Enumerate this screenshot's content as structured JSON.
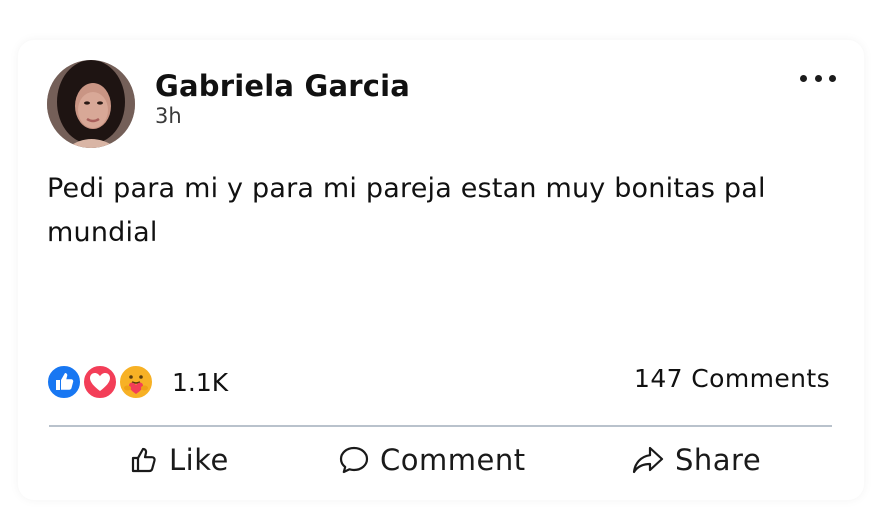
{
  "post": {
    "author_name": "Gabriela Garcia",
    "timestamp": "3h",
    "text": "Pedi para mi y para mi pareja estan muy bonitas pal mundial"
  },
  "reactions": {
    "icons": [
      "like-icon",
      "love-icon",
      "care-icon"
    ],
    "count": "1.1K"
  },
  "comments": {
    "count_label": "147 Comments"
  },
  "actions": {
    "like": "Like",
    "comment": "Comment",
    "share": "Share"
  },
  "colors": {
    "like_blue": "#1877F2",
    "love_red": "#F33E58",
    "care_yellow": "#F7B125",
    "divider": "#B9C2CC"
  }
}
